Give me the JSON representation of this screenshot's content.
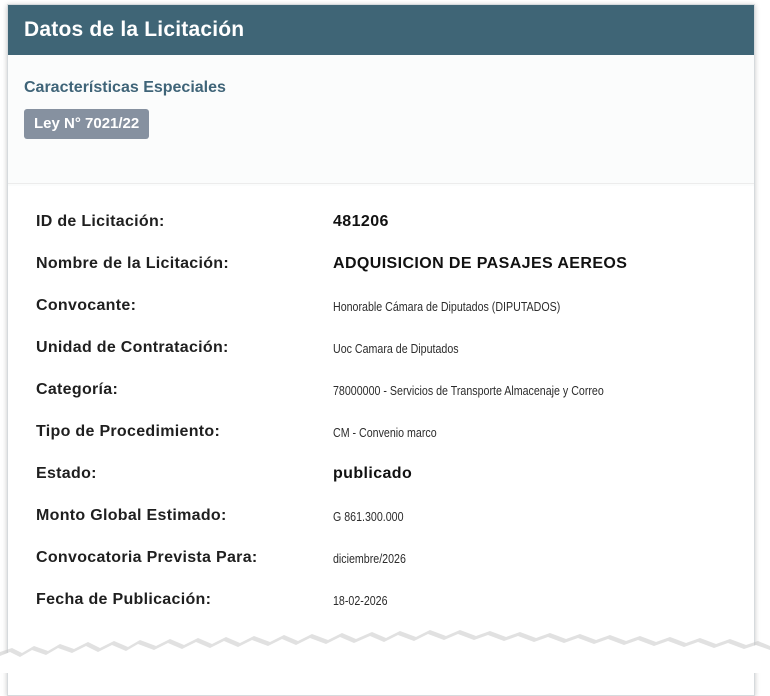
{
  "header": {
    "title": "Datos de la Licitación"
  },
  "special": {
    "title": "Características Especiales",
    "badge": "Ley N° 7021/22"
  },
  "details": [
    {
      "label": "ID de Licitación:",
      "value": "481206"
    },
    {
      "label": "Nombre de la Licitación:",
      "value": "ADQUISICION DE PASAJES AEREOS"
    },
    {
      "label": "Convocante:",
      "value": "Honorable Cámara de Diputados (DIPUTADOS)"
    },
    {
      "label": "Unidad de Contratación:",
      "value": "Uoc Camara de Diputados"
    },
    {
      "label": "Categoría:",
      "value": "78000000 - Servicios de Transporte Almacenaje y Correo"
    },
    {
      "label": "Tipo de Procedimiento:",
      "value": "CM - Convenio marco"
    },
    {
      "label": "Estado:",
      "value": "publicado"
    },
    {
      "label": "Monto Global Estimado:",
      "value": "G 861.300.000"
    },
    {
      "label": "Convocatoria Prevista Para:",
      "value": "diciembre/2026"
    },
    {
      "label": "Fecha de Publicación:",
      "value": "18-02-2026"
    }
  ]
}
